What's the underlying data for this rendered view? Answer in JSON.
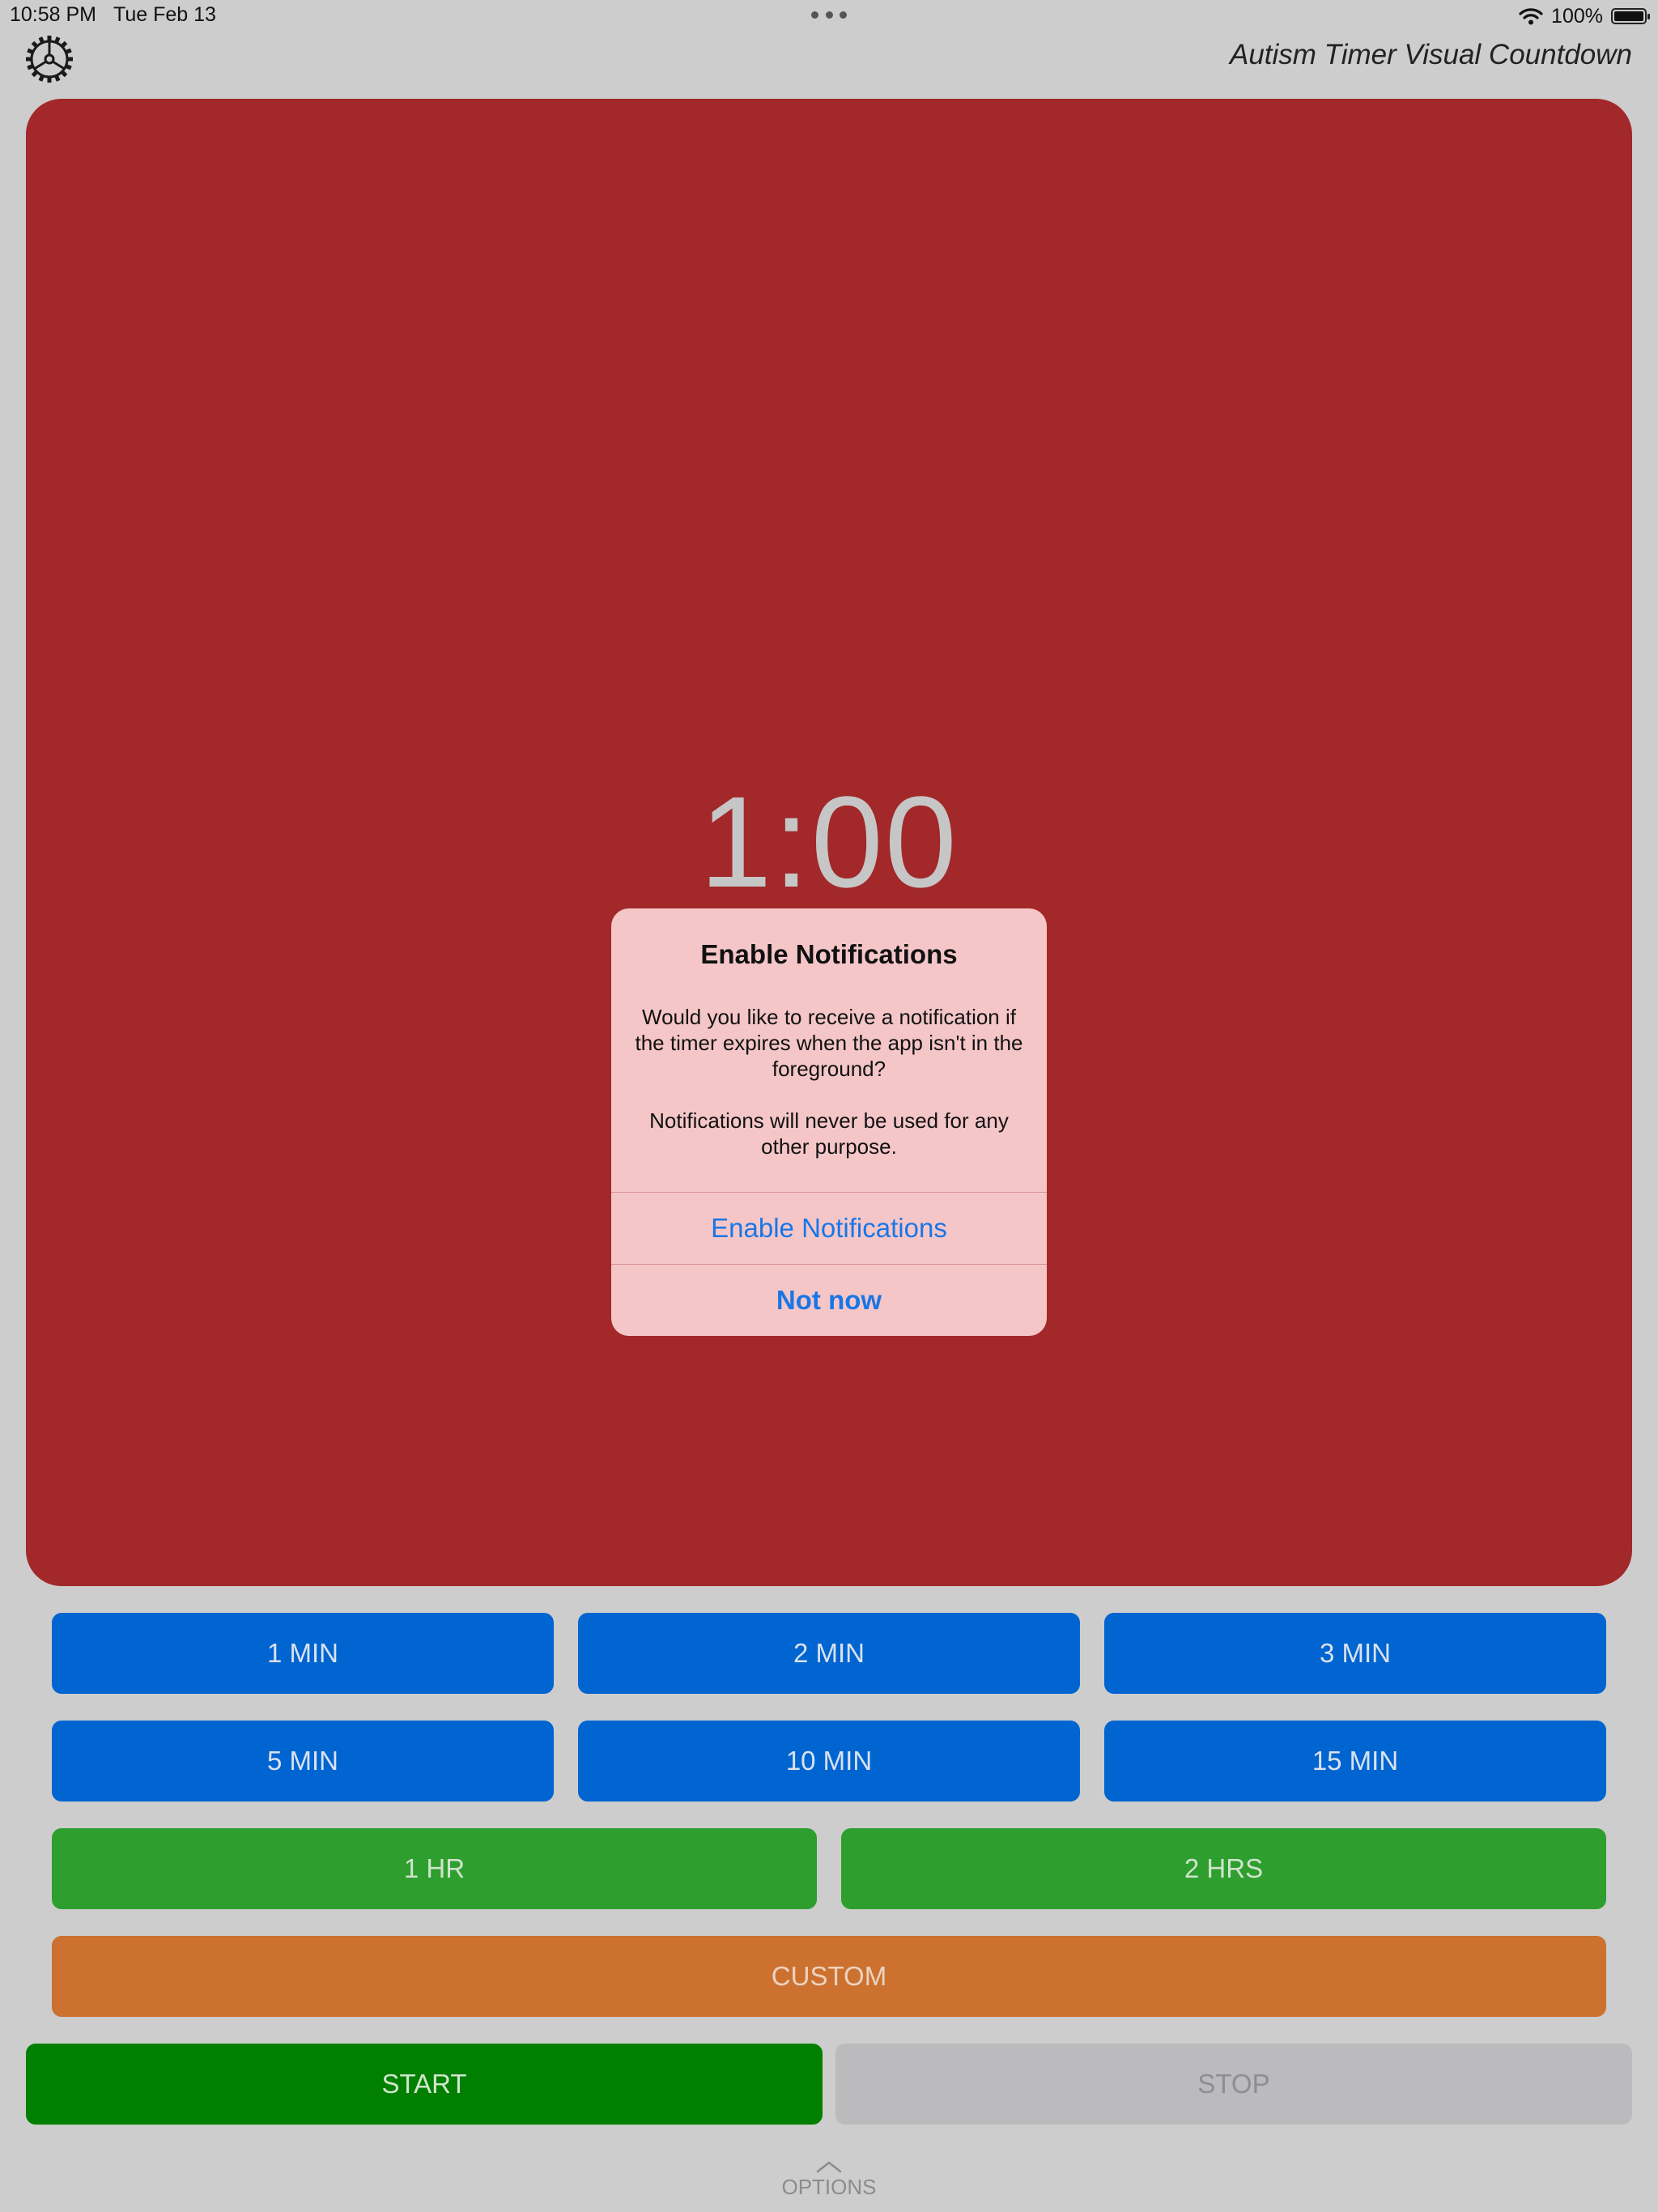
{
  "status_bar": {
    "time": "10:58 PM",
    "date": "Tue Feb 13",
    "battery_label": "100%",
    "battery_level": 1.0
  },
  "header": {
    "title": "Autism Timer Visual Countdown",
    "settings_icon": "gear-icon"
  },
  "timer": {
    "display": "1:00",
    "panel_color": "#a2282a"
  },
  "dialog": {
    "title": "Enable Notifications",
    "message": "Would you like to receive a notification if the timer expires when the app isn't in the foreground?",
    "note": "Notifications will never be used for any other purpose.",
    "primary_action": "Enable Notifications",
    "secondary_action": "Not now",
    "action_color": "#1877e6"
  },
  "presets": {
    "row1": [
      "1 MIN",
      "2 MIN",
      "3 MIN"
    ],
    "row2": [
      "5 MIN",
      "10 MIN",
      "15 MIN"
    ],
    "row3": [
      "1 HR",
      "2 HRS"
    ],
    "custom": "CUSTOM"
  },
  "controls": {
    "start": "START",
    "stop": "STOP"
  },
  "footer": {
    "options_label": "OPTIONS",
    "options_icon": "chevron-up-icon"
  },
  "colors": {
    "minute_buttons": "#0064d1",
    "hour_buttons": "#2e9e2e",
    "custom_button": "#cc712f",
    "start_button": "#007f00",
    "stop_button": "#bbbbbd"
  }
}
